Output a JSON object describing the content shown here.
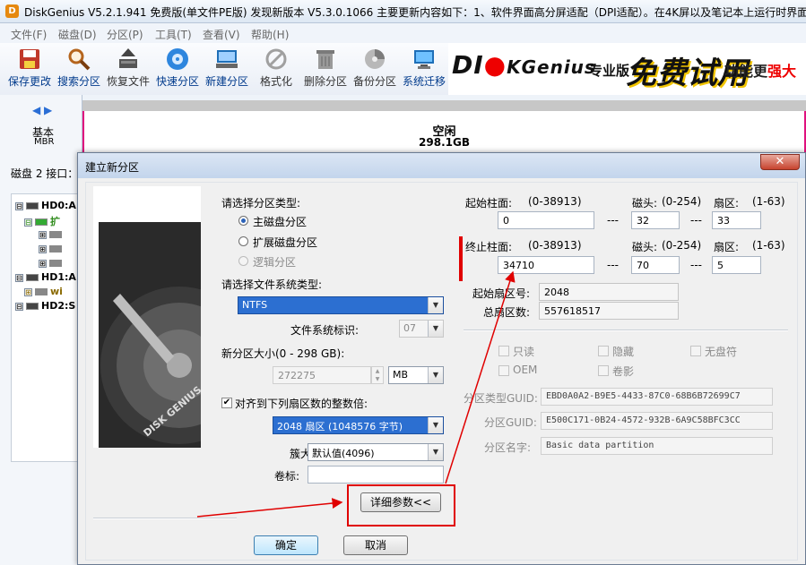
{
  "window": {
    "app_icon_letter": "D",
    "title": "DiskGenius V5.2.1.941 免费版(单文件PE版)  发现新版本 V5.3.0.1066 主要更新内容如下：1、软件界面高分屏适配（DPI适配）。在4K屏以及笔记本上运行时界面"
  },
  "menu": [
    "文件(F)",
    "磁盘(D)",
    "分区(P)",
    "工具(T)",
    "查看(V)",
    "帮助(H)"
  ],
  "toolbar": [
    {
      "label": "保存更改",
      "icon": "save-icon"
    },
    {
      "label": "搜索分区",
      "icon": "search-icon"
    },
    {
      "label": "恢复文件",
      "icon": "recover-file-icon"
    },
    {
      "label": "快速分区",
      "icon": "quick-partition-icon"
    },
    {
      "label": "新建分区",
      "icon": "new-partition-icon"
    },
    {
      "label": "格式化",
      "icon": "format-icon"
    },
    {
      "label": "删除分区",
      "icon": "delete-icon"
    },
    {
      "label": "备份分区",
      "icon": "backup-icon"
    },
    {
      "label": "系统迁移",
      "icon": "migrate-icon"
    }
  ],
  "banner": {
    "logo_left": "DI",
    "logo_right": "KGenius",
    "edition": "专业版",
    "promo": "免费试用",
    "more_a": "功能更",
    "more_b": "强大"
  },
  "disk_panel": {
    "basic": "基本",
    "mbr": "MBR",
    "interface": "磁盘 2 接口：",
    "free_label": "空闲",
    "free_size": "298.1GB"
  },
  "tree": [
    {
      "expander": "⊟",
      "label": "HD0:A"
    },
    {
      "expander": "⊟",
      "label": "扩"
    },
    {
      "expander": "⊞",
      "label": ""
    },
    {
      "expander": "⊞",
      "label": ""
    },
    {
      "expander": "⊞",
      "label": ""
    },
    {
      "expander": "⊟",
      "label": "HD1:A"
    },
    {
      "expander": "⊞",
      "label": "wi"
    },
    {
      "expander": "⊟",
      "label": "HD2:S"
    }
  ],
  "dialog": {
    "title": "建立新分区",
    "close_glyph": "✕",
    "image_text": "DISK GENIUS",
    "partition_type_label": "请选择分区类型:",
    "partition_types": [
      "主磁盘分区",
      "扩展磁盘分区",
      "逻辑分区"
    ],
    "fs_type_label": "请选择文件系统类型:",
    "fs_type": "NTFS",
    "fs_id_label": "文件系统标识:",
    "fs_id": "07",
    "size_label": "新分区大小(0 - 298 GB):",
    "size_value": "272275",
    "size_unit": "MB",
    "align_label": "对齐到下列扇区数的整数倍:",
    "align_value": "2048 扇区 (1048576 字节)",
    "cluster_label": "簇大小:",
    "cluster_value": "默认值(4096)",
    "volume_label": "卷标:",
    "volume_value": "",
    "details_button": "详细参数<<",
    "ok_button": "确定",
    "cancel_button": "取消",
    "start_cyl_label": "起始柱面:",
    "cyl_range": "(0-38913)",
    "head_label": "磁头:",
    "head_range": "(0-254)",
    "sector_label": "扇区:",
    "sector_range": "(1-63)",
    "start_cyl": "0",
    "start_head": "32",
    "start_sector": "33",
    "end_cyl_label": "终止柱面:",
    "end_cyl": "34710",
    "end_head": "70",
    "end_sector": "5",
    "dash": "---",
    "start_lba_label": "起始扇区号:",
    "start_lba": "2048",
    "total_sectors_label": "总扇区数:",
    "total_sectors": "557618517",
    "attr_readonly": "只读",
    "attr_hidden": "隐藏",
    "attr_no_letter": "无盘符",
    "attr_oem": "OEM",
    "attr_shadow": "卷影",
    "type_guid_label": "分区类型GUID:",
    "type_guid": "EBD0A0A2-B9E5-4433-87C0-68B6B72699C7",
    "part_guid_label": "分区GUID:",
    "part_guid": "E500C171-0B24-4572-932B-6A9C58BFC3CC",
    "part_name_label": "分区名字:",
    "part_name": "Basic data partition"
  },
  "colors": {
    "annotation_red": "#e00000",
    "free_border": "#e0117e",
    "accent_blue": "#2c6fd1"
  }
}
